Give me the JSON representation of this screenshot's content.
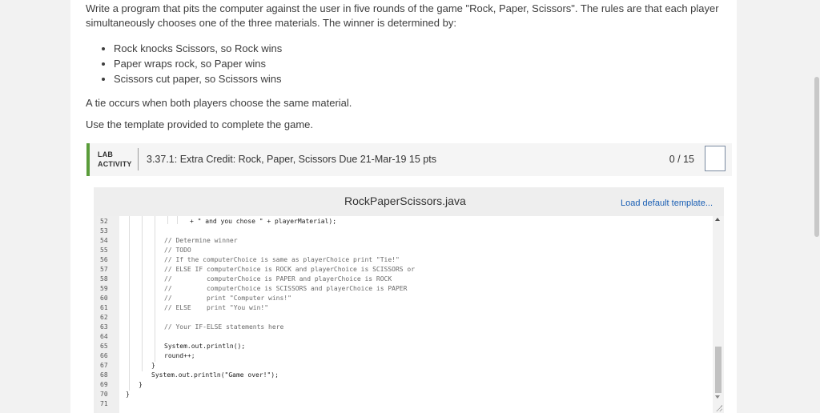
{
  "description": {
    "intro": "Write a program that pits the computer against the user in five rounds of the game \"Rock, Paper, Scissors\". The rules are that each player simultaneously chooses one of the three materials. The winner is determined by:",
    "rules": [
      "Rock knocks Scissors, so Rock wins",
      "Paper wraps rock, so Paper wins",
      "Scissors cut paper, so Scissors wins"
    ],
    "tie_note": "A tie occurs when both players choose the same material.",
    "template_note": "Use the template provided to complete the game."
  },
  "lab": {
    "tag_line1": "LAB",
    "tag_line2": "ACTIVITY",
    "title": "3.37.1: Extra Credit: Rock, Paper, Scissors Due 21-Mar-19 15 pts",
    "score": "0 / 15"
  },
  "editor": {
    "file_name": "RockPaperScissors.java",
    "load_template_label": "Load default template...",
    "line_numbers": [
      "52",
      "53",
      "54",
      "55",
      "56",
      "57",
      "58",
      "59",
      "60",
      "61",
      "62",
      "63",
      "64",
      "65",
      "66",
      "67",
      "68",
      "69",
      "70",
      "71"
    ],
    "lines": [
      "+ \" and you chose \" + playerMaterial);",
      "",
      "// Determine winner",
      "// TODO",
      "// If the computerChoice is same as playerChoice print \"Tie!\"",
      "// ELSE IF computerChoice is ROCK and playerChoice is SCISSORS or",
      "//         computerChoice is PAPER and playerChoice is ROCK",
      "//         computerChoice is SCISSORS and playerChoice is PAPER",
      "//         print \"Computer wins!\"",
      "// ELSE    print \"You win!\"",
      "",
      "// Your IF-ELSE statements here",
      "",
      "System.out.println();",
      "round++;",
      "}",
      "System.out.println(\"Game over!\");",
      "}",
      "}",
      ""
    ]
  },
  "colors": {
    "accent_green": "#5a9c3a",
    "link_blue": "#1a5fb4",
    "string_blue": "#1a3fa8"
  }
}
